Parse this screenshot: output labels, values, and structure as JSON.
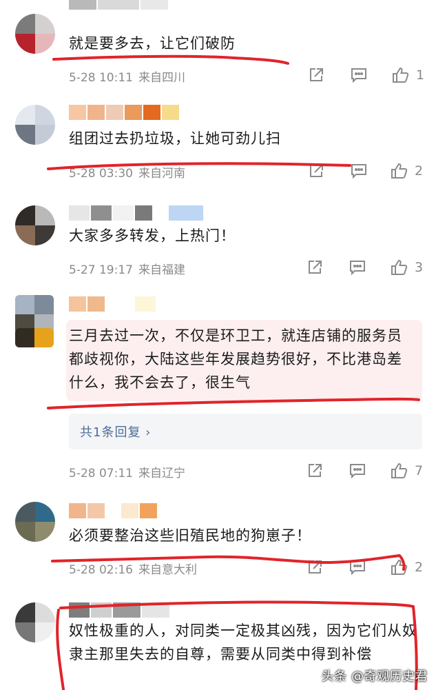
{
  "comments": [
    {
      "text": "就是要多去，让它们破防",
      "date": "5-28 10:11",
      "location": "来自四川",
      "likes": "1"
    },
    {
      "text": "组团过去扔垃圾，让她可劲儿扫",
      "date": "5-28 03:30",
      "location": "来自河南",
      "likes": "2"
    },
    {
      "text": "大家多多转发，上热门！",
      "date": "5-27 19:17",
      "location": "来自福建",
      "likes": "3"
    },
    {
      "text": "三月去过一次，不仅是环卫工，就连店铺的服务员都歧视你，大陆这些年发展趋势很好，不比港岛差什么，我不会去了，很生气",
      "reply_link": "共1条回复 ›",
      "date": "5-28 07:11",
      "location": "来自辽宁",
      "likes": "7"
    },
    {
      "text": "必须要整治这些旧殖民地的狗崽子！",
      "date": "5-28 02:16",
      "location": "来自意大利",
      "likes": "2"
    },
    {
      "text": "奴性极重的人，对同类一定极其凶残，因为它们从奴隶主那里失去的自尊，需要从同类中得到补偿"
    }
  ],
  "watermark": "头条 @奇观历史君",
  "colors": {
    "annotation_red": "#e0242a",
    "meta_gray": "#8a8a8a",
    "reply_blue": "#4e6b9a"
  },
  "icons": [
    "share-icon",
    "comment-icon",
    "like-icon",
    "chevron-right-icon"
  ]
}
